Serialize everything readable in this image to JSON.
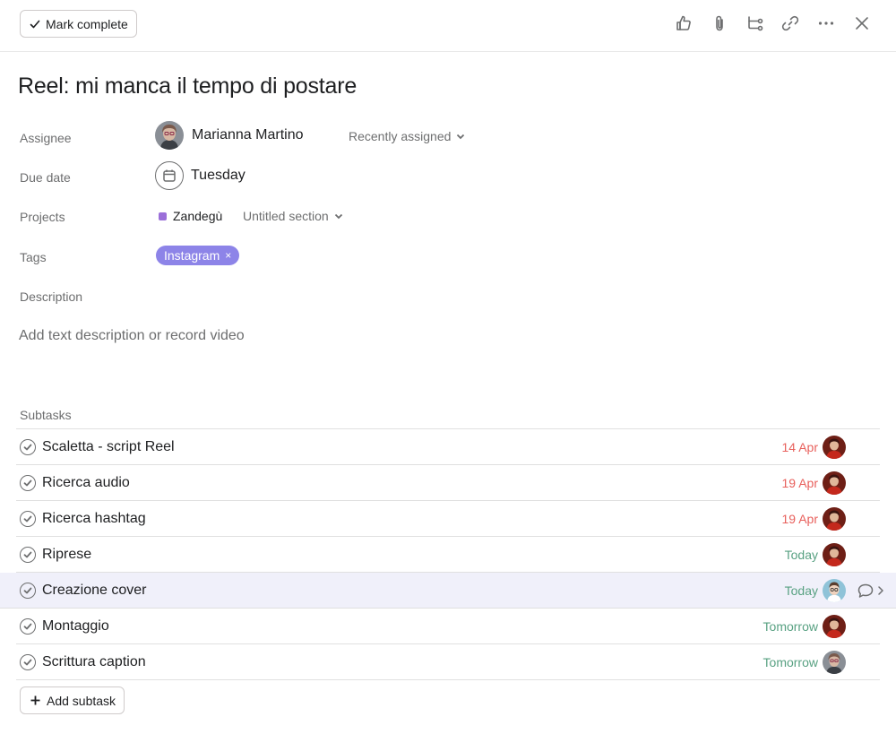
{
  "toolbar": {
    "mark_complete_label": "Mark complete",
    "icons": [
      "like-icon",
      "attachment-icon",
      "subtask-icon",
      "link-icon",
      "more-icon",
      "close-icon"
    ]
  },
  "task": {
    "title": "Reel: mi manca il tempo di postare"
  },
  "fields": {
    "assignee_label": "Assignee",
    "assignee_name": "Marianna Martino",
    "recently_assigned": "Recently assigned",
    "due_date_label": "Due date",
    "due_date_value": "Tuesday",
    "projects_label": "Projects",
    "project_name": "Zandegù",
    "project_section": "Untitled section",
    "project_color": "#9b6fd9",
    "tags_label": "Tags",
    "tag_name": "Instagram",
    "tag_remove": "×",
    "tag_color": "#8d84e8",
    "description_label": "Description",
    "description_placeholder": "Add text description or record video"
  },
  "subtasks": {
    "label": "Subtasks",
    "items": [
      {
        "name": "Scaletta - script Reel",
        "date": "14 Apr",
        "date_status": "overdue",
        "assignee": "red-avatar"
      },
      {
        "name": "Ricerca audio",
        "date": "19 Apr",
        "date_status": "overdue",
        "assignee": "red-avatar"
      },
      {
        "name": "Ricerca hashtag",
        "date": "19 Apr",
        "date_status": "overdue",
        "assignee": "red-avatar"
      },
      {
        "name": "Riprese",
        "date": "Today",
        "date_status": "upcoming",
        "assignee": "red-avatar"
      },
      {
        "name": "Creazione cover",
        "date": "Today",
        "date_status": "upcoming",
        "assignee": "blue-avatar",
        "highlighted": true
      },
      {
        "name": "Montaggio",
        "date": "Tomorrow",
        "date_status": "upcoming",
        "assignee": "red-avatar"
      },
      {
        "name": "Scrittura caption",
        "date": "Tomorrow",
        "date_status": "upcoming",
        "assignee": "gray-avatar"
      }
    ],
    "add_label": "Add subtask"
  },
  "colors": {
    "overdue": "#e8605c",
    "upcoming": "#58a182",
    "highlight_row": "#f0f0fa"
  }
}
